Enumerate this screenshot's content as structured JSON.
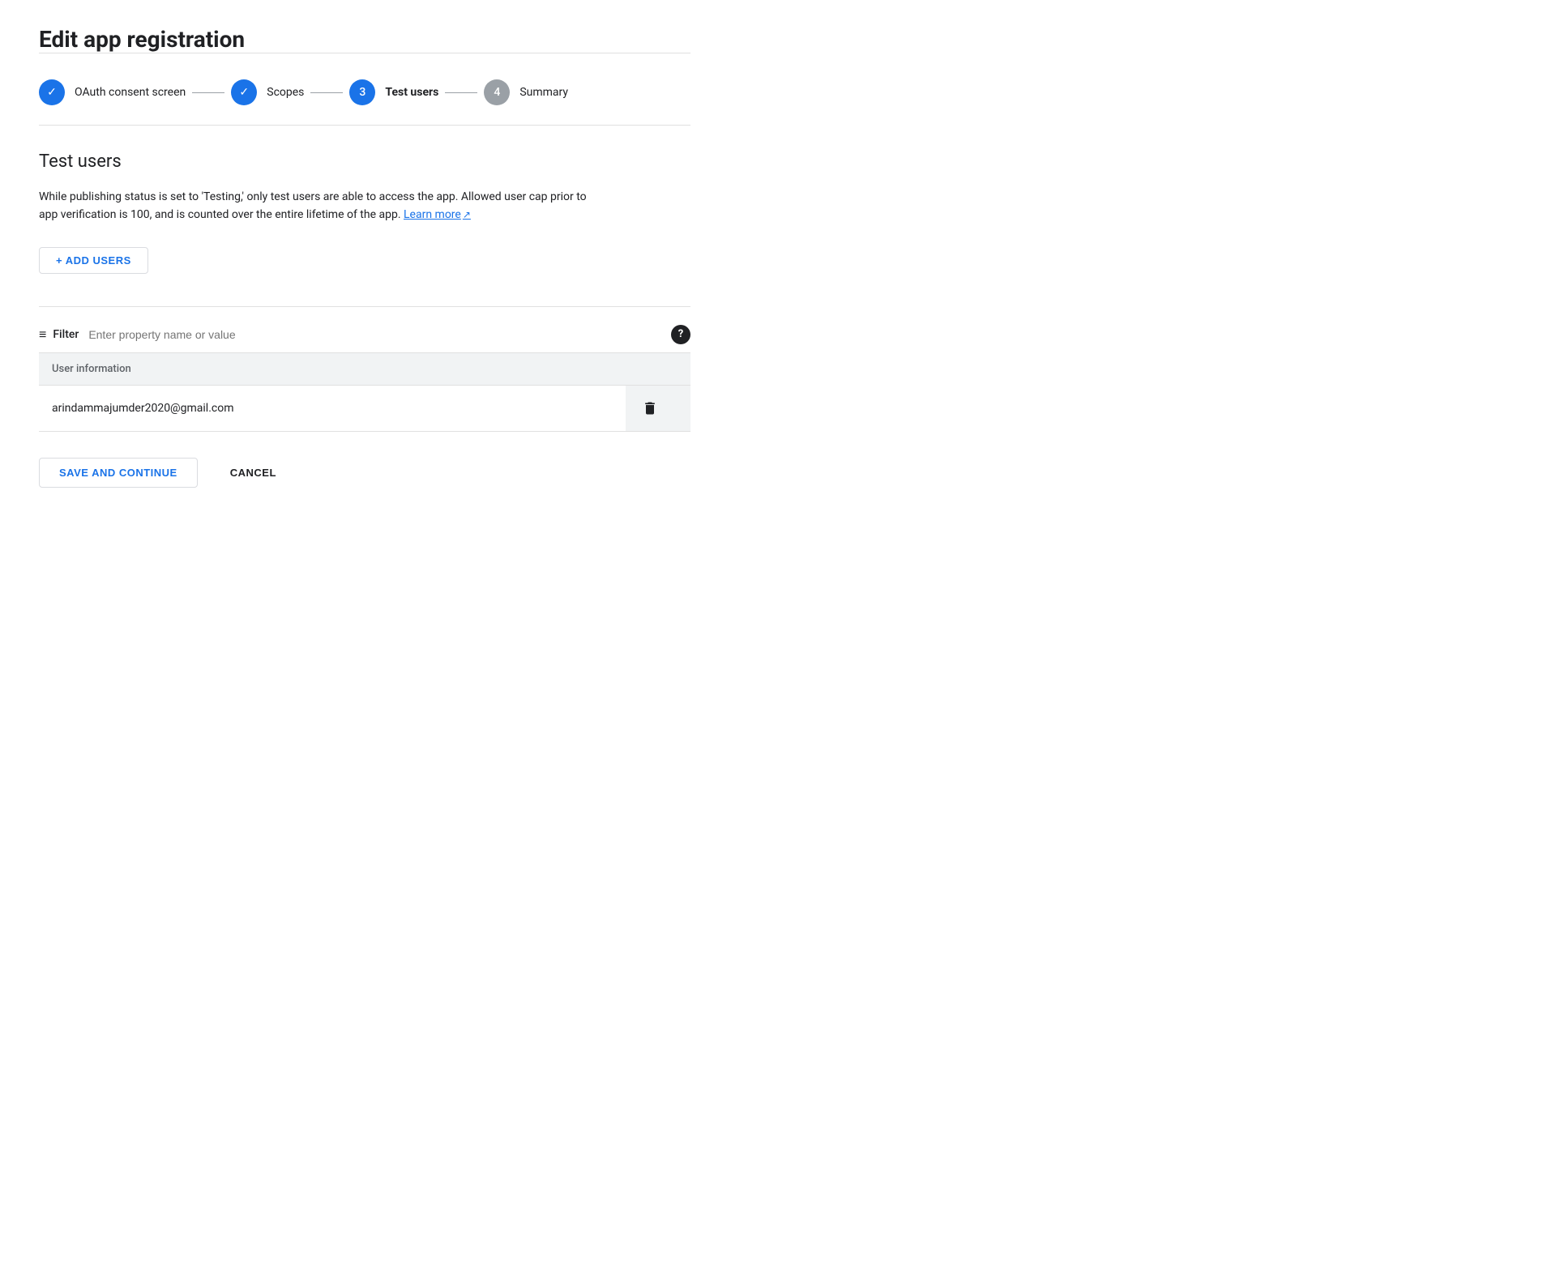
{
  "page": {
    "title": "Edit app registration"
  },
  "stepper": {
    "steps": [
      {
        "id": "oauth",
        "label": "OAuth consent screen",
        "state": "completed",
        "number": "✓"
      },
      {
        "id": "scopes",
        "label": "Scopes",
        "state": "completed",
        "number": "✓"
      },
      {
        "id": "test-users",
        "label": "Test users",
        "state": "active",
        "number": "3"
      },
      {
        "id": "summary",
        "label": "Summary",
        "state": "inactive",
        "number": "4"
      }
    ]
  },
  "main": {
    "section_title": "Test users",
    "description": "While publishing status is set to 'Testing,' only test users are able to access the app. Allowed user cap prior to app verification is 100, and is counted over the entire lifetime of the app.",
    "learn_more_label": "Learn more",
    "add_users_label": "+ ADD USERS",
    "filter": {
      "label": "Filter",
      "placeholder": "Enter property name or value"
    },
    "table": {
      "headers": [
        "User information",
        ""
      ],
      "rows": [
        {
          "email": "arindammajumder2020@gmail.com"
        }
      ]
    }
  },
  "actions": {
    "save_label": "SAVE AND CONTINUE",
    "cancel_label": "CANCEL"
  }
}
